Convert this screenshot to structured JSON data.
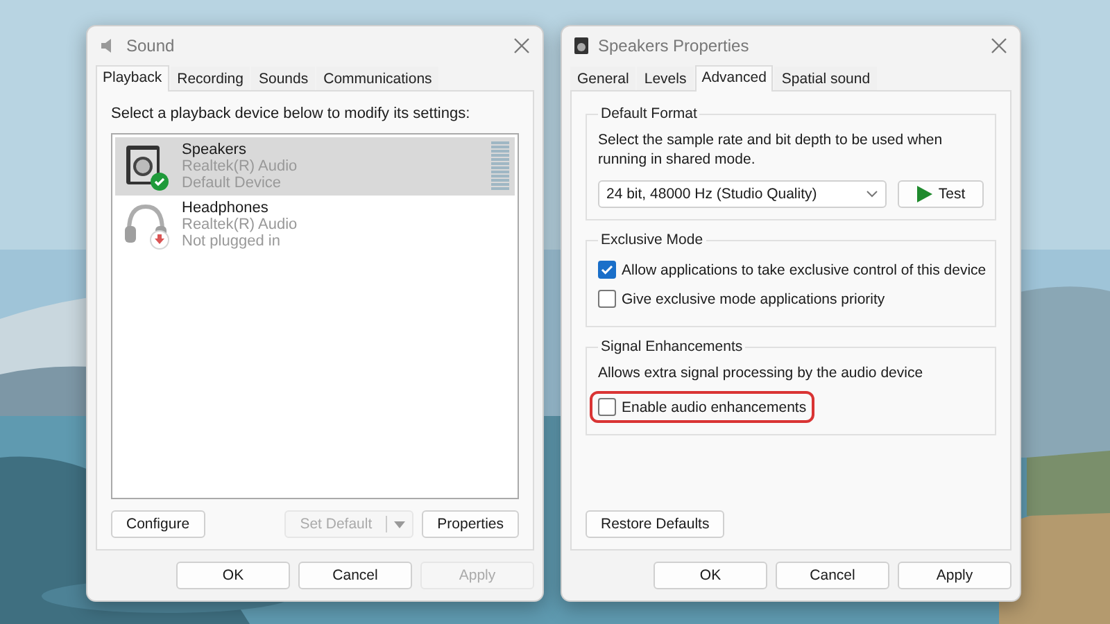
{
  "sound_window": {
    "title": "Sound",
    "tabs": [
      {
        "label": "Playback",
        "selected": true
      },
      {
        "label": "Recording",
        "selected": false
      },
      {
        "label": "Sounds",
        "selected": false
      },
      {
        "label": "Communications",
        "selected": false
      }
    ],
    "instruction": "Select a playback device below to modify its settings:",
    "devices": [
      {
        "kind": "speaker",
        "name": "Speakers",
        "driver": "Realtek(R) Audio",
        "status": "Default Device",
        "default_device": true,
        "plugged_in": true,
        "selected": true
      },
      {
        "kind": "headphones",
        "name": "Headphones",
        "driver": "Realtek(R) Audio",
        "status": "Not plugged in",
        "default_device": false,
        "plugged_in": false,
        "selected": false
      }
    ],
    "list_buttons": [
      {
        "label": "Configure",
        "disabled": false
      }
    ],
    "set_default": {
      "label": "Set Default",
      "disabled": true
    },
    "properties_button": {
      "label": "Properties",
      "disabled": false
    },
    "footer_buttons": [
      {
        "label": "OK",
        "disabled": false
      },
      {
        "label": "Cancel",
        "disabled": false
      },
      {
        "label": "Apply",
        "disabled": true
      }
    ]
  },
  "properties_window": {
    "title": "Speakers Properties",
    "tabs": [
      {
        "label": "General",
        "selected": false
      },
      {
        "label": "Levels",
        "selected": false
      },
      {
        "label": "Advanced",
        "selected": true
      },
      {
        "label": "Spatial sound",
        "selected": false
      }
    ],
    "groups": [
      {
        "title": "Default Format",
        "description": "Select the sample rate and bit depth to be used when running in shared mode.",
        "format": "24 bit, 48000 Hz (Studio Quality)",
        "test_button": "Test"
      },
      {
        "title": "Exclusive Mode",
        "options": [
          {
            "label": "Allow applications to take exclusive control of this device",
            "checked": true,
            "highlighted": false
          },
          {
            "label": "Give exclusive mode applications priority",
            "checked": false,
            "highlighted": false
          }
        ]
      },
      {
        "title": "Signal Enhancements",
        "description": "Allows extra signal processing by the audio device",
        "options": [
          {
            "label": "Enable audio enhancements",
            "checked": false,
            "highlighted": true
          }
        ]
      }
    ],
    "restore_button": {
      "label": "Restore Defaults",
      "disabled": false
    },
    "footer_buttons": [
      {
        "label": "OK",
        "disabled": false
      },
      {
        "label": "Cancel",
        "disabled": false
      },
      {
        "label": "Apply",
        "disabled": false
      }
    ]
  }
}
